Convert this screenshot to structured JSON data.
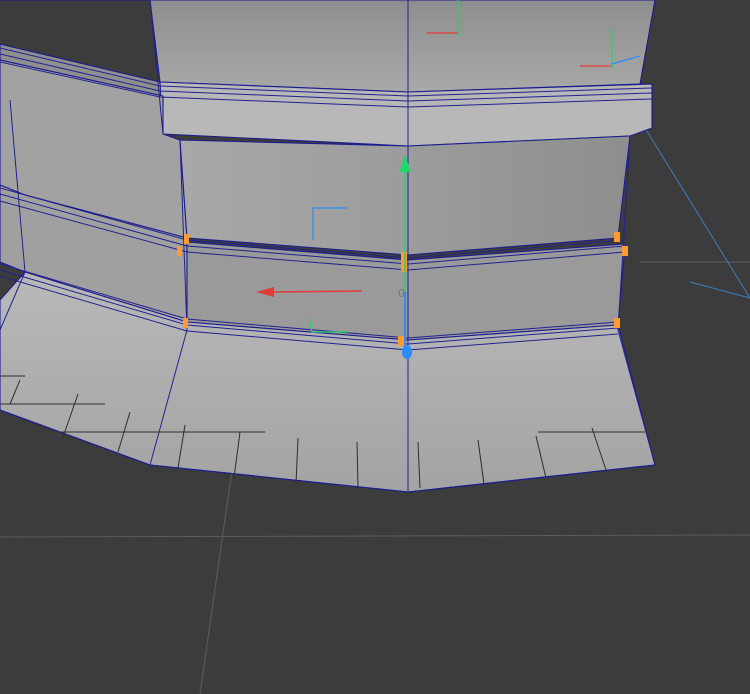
{
  "viewport": {
    "background_color": "#3c3c3c",
    "mesh_fill": "#a7a7a7",
    "wire_color": "#1a1a8c",
    "grid_color": "#5a5a5a",
    "selection_color": "#ff9a30",
    "gizmo": {
      "x_axis_color": "#e23a3a",
      "y_axis_color": "#22d46a",
      "z_axis_color": "#2a8cff",
      "center_label": "0"
    }
  }
}
